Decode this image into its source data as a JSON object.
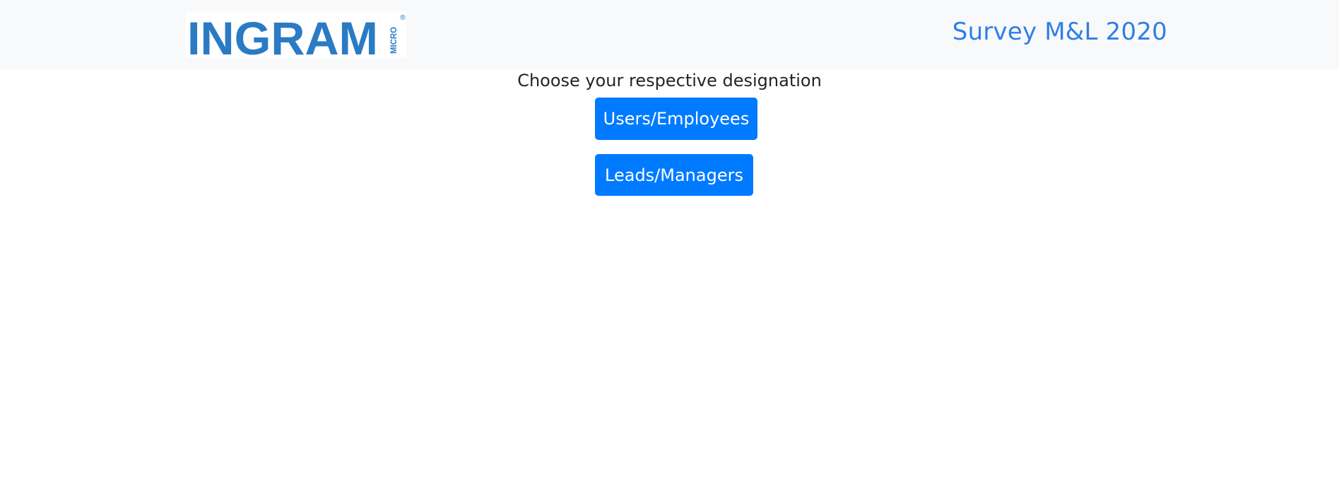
{
  "header": {
    "logo_text": "INGRAM",
    "logo_subtext": "MICRO",
    "logo_mark": "®",
    "title": "Survey M&L 2020",
    "brand_color": "#2f7fe6",
    "logo_color": "#2a7bc4"
  },
  "main": {
    "prompt": "Choose your respective designation",
    "buttons": [
      {
        "label": "Users/Employees"
      },
      {
        "label": "Leads/Managers"
      }
    ],
    "button_color": "#007bff"
  }
}
